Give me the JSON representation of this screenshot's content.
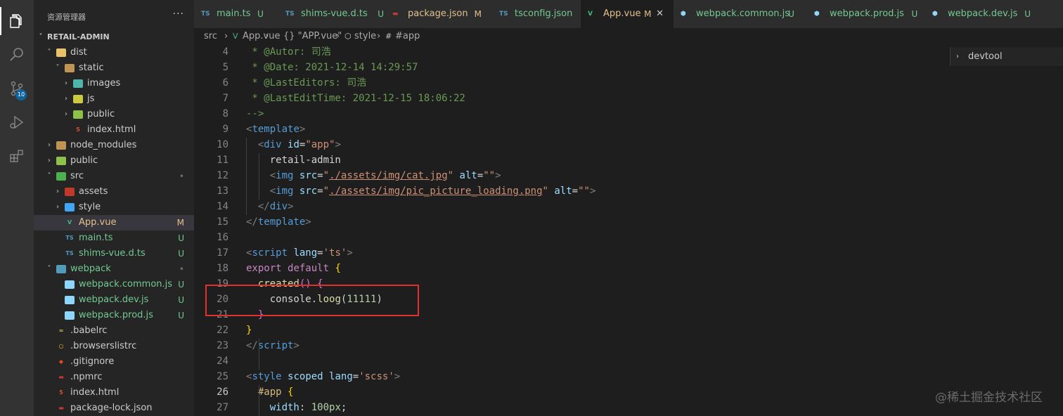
{
  "explorer": {
    "title": "资源管理器",
    "more": "···",
    "root_label": "RETAIL-ADMIN",
    "items": [
      {
        "label": "dist",
        "chev": "˅",
        "icon": "folder-icon",
        "color": "#e8c36a"
      },
      {
        "label": "static",
        "chev": "˅",
        "icon": "folder-open-icon",
        "color": "#c09553"
      },
      {
        "label": "images",
        "chev": "›",
        "icon": "images-folder-icon",
        "color": "#4db6ac"
      },
      {
        "label": "js",
        "chev": "›",
        "icon": "js-folder-icon",
        "color": "#cbcb41"
      },
      {
        "label": "public",
        "chev": "›",
        "icon": "public-folder-icon",
        "color": "#8dc149"
      },
      {
        "label": "index.html",
        "chev": "",
        "icon": "html5-icon",
        "color": "#e44d26",
        "glyph": "5"
      },
      {
        "label": "node_modules",
        "chev": "›",
        "icon": "folder-icon",
        "color": "#c09553"
      },
      {
        "label": "public",
        "chev": "›",
        "icon": "public-folder-icon",
        "color": "#8dc149"
      },
      {
        "label": "src",
        "chev": "˅",
        "icon": "src-folder-icon",
        "color": "#4caf50",
        "status": "•"
      },
      {
        "label": "assets",
        "chev": "›",
        "icon": "assets-folder-icon",
        "color": "#c0392b"
      },
      {
        "label": "style",
        "chev": "›",
        "icon": "style-folder-icon",
        "color": "#42a5f5"
      },
      {
        "label": "App.vue",
        "chev": "",
        "icon": "vue-icon",
        "color": "#41b883",
        "glyph": "V",
        "status": "M",
        "text_color": "#e2c08d"
      },
      {
        "label": "main.ts",
        "chev": "",
        "icon": "typescript-icon",
        "color": "#519aba",
        "glyph": "TS",
        "status": "U",
        "text_color": "#73c991"
      },
      {
        "label": "shims-vue.d.ts",
        "chev": "",
        "icon": "typescript-icon",
        "color": "#519aba",
        "glyph": "TS",
        "status": "U",
        "text_color": "#73c991"
      },
      {
        "label": "webpack",
        "chev": "˅",
        "icon": "webpack-folder-icon",
        "color": "#519aba",
        "status": "•",
        "text_color": "#73c991"
      },
      {
        "label": "webpack.common.js",
        "chev": "",
        "icon": "webpack-icon",
        "color": "#8ed6fb",
        "status": "U",
        "text_color": "#73c991"
      },
      {
        "label": "webpack.dev.js",
        "chev": "",
        "icon": "webpack-icon",
        "color": "#8ed6fb",
        "status": "U",
        "text_color": "#73c991"
      },
      {
        "label": "webpack.prod.js",
        "chev": "",
        "icon": "webpack-icon",
        "color": "#8ed6fb",
        "status": "U",
        "text_color": "#73c991"
      },
      {
        "label": ".babelrc",
        "chev": "",
        "icon": "babel-icon",
        "color": "#cbcb41",
        "glyph": "≈"
      },
      {
        "label": ".browserslistrc",
        "chev": "",
        "icon": "browserslist-icon",
        "color": "#f5c518",
        "glyph": "○"
      },
      {
        "label": ".gitignore",
        "chev": "",
        "icon": "git-icon",
        "color": "#e64a19",
        "glyph": "◆"
      },
      {
        "label": ".npmrc",
        "chev": "",
        "icon": "npm-icon",
        "color": "#cb3837",
        "glyph": "▬"
      },
      {
        "label": "index.html",
        "chev": "",
        "icon": "html5-icon",
        "color": "#e44d26",
        "glyph": "5"
      },
      {
        "label": "package-lock.json",
        "chev": "",
        "icon": "npm-icon",
        "color": "#cb3837",
        "glyph": "▬"
      }
    ]
  },
  "tabs": [
    {
      "label": "main.ts",
      "status": "U",
      "glyph": "TS",
      "icon": "typescript-icon",
      "color": "#519aba",
      "text_color": "#73c991"
    },
    {
      "label": "shims-vue.d.ts",
      "status": "U",
      "glyph": "TS",
      "icon": "typescript-icon",
      "color": "#519aba",
      "text_color": "#73c991"
    },
    {
      "label": "package.json",
      "status": "M",
      "glyph": "▬",
      "icon": "npm-icon",
      "color": "#cb3837",
      "text_color": "#e2c08d"
    },
    {
      "label": "tsconfig.json",
      "status": "U",
      "glyph": "TS",
      "icon": "typescript-icon",
      "color": "#519aba",
      "text_color": "#73c991"
    },
    {
      "label": "App.vue",
      "status": "M",
      "glyph": "V",
      "icon": "vue-icon",
      "color": "#41b883",
      "text_color": "#e2c08d",
      "active": true,
      "close": "✕"
    },
    {
      "label": "webpack.common.js",
      "status": "U",
      "glyph": "⬢",
      "icon": "webpack-icon",
      "color": "#8ed6fb",
      "text_color": "#73c991"
    },
    {
      "label": "webpack.prod.js",
      "status": "U",
      "glyph": "⬢",
      "icon": "webpack-icon",
      "color": "#8ed6fb",
      "text_color": "#73c991"
    },
    {
      "label": "webpack.dev.js",
      "status": "U",
      "glyph": "⬢",
      "icon": "webpack-icon",
      "color": "#8ed6fb",
      "text_color": "#73c991"
    }
  ],
  "breadcrumbs": [
    "src",
    "App.vue",
    "{} \"APP.vue\"",
    "style",
    "#app"
  ],
  "breadcrumb_sep": "›",
  "outline": {
    "label": "devtool",
    "chev": "›"
  },
  "code_lines": [
    {
      "n": "4",
      "tokens": [
        [
          "t-comment",
          " * @Autor: 司浩"
        ]
      ]
    },
    {
      "n": "5",
      "tokens": [
        [
          "t-comment",
          " * @Date: 2021-12-14 14:29:57"
        ]
      ]
    },
    {
      "n": "6",
      "tokens": [
        [
          "t-comment",
          " * @LastEditors: 司浩"
        ]
      ]
    },
    {
      "n": "7",
      "tokens": [
        [
          "t-comment",
          " * @LastEditTime: 2021-12-15 18:06:22"
        ]
      ]
    },
    {
      "n": "8",
      "tokens": [
        [
          "t-comment",
          "-->"
        ]
      ]
    },
    {
      "n": "9",
      "tokens": [
        [
          "t-punct",
          "<"
        ],
        [
          "t-tag",
          "template"
        ],
        [
          "t-punct",
          ">"
        ]
      ]
    },
    {
      "n": "10",
      "tokens": [
        [
          "t-text",
          "  "
        ],
        [
          "t-punct",
          "<"
        ],
        [
          "t-tag",
          "div"
        ],
        [
          "t-text",
          " "
        ],
        [
          "t-attr",
          "id"
        ],
        [
          "t-text",
          "="
        ],
        [
          "t-str",
          "\"app\""
        ],
        [
          "t-punct",
          ">"
        ]
      ]
    },
    {
      "n": "11",
      "tokens": [
        [
          "t-text",
          "    retail-admin"
        ]
      ]
    },
    {
      "n": "12",
      "tokens": [
        [
          "t-text",
          "    "
        ],
        [
          "t-punct",
          "<"
        ],
        [
          "t-tag",
          "img"
        ],
        [
          "t-text",
          " "
        ],
        [
          "t-attr",
          "src"
        ],
        [
          "t-text",
          "="
        ],
        [
          "t-str",
          "\""
        ],
        [
          "t-link",
          "./assets/img/cat.jpg"
        ],
        [
          "t-str",
          "\""
        ],
        [
          "t-text",
          " "
        ],
        [
          "t-attr",
          "alt"
        ],
        [
          "t-text",
          "="
        ],
        [
          "t-str",
          "\"\""
        ],
        [
          "t-punct",
          ">"
        ]
      ]
    },
    {
      "n": "13",
      "tokens": [
        [
          "t-text",
          "    "
        ],
        [
          "t-punct",
          "<"
        ],
        [
          "t-tag",
          "img"
        ],
        [
          "t-text",
          " "
        ],
        [
          "t-attr",
          "src"
        ],
        [
          "t-text",
          "="
        ],
        [
          "t-str",
          "\""
        ],
        [
          "t-link",
          "./assets/img/pic_picture_loading.png"
        ],
        [
          "t-str",
          "\""
        ],
        [
          "t-text",
          " "
        ],
        [
          "t-attr",
          "alt"
        ],
        [
          "t-text",
          "="
        ],
        [
          "t-str",
          "\"\""
        ],
        [
          "t-punct",
          ">"
        ]
      ]
    },
    {
      "n": "14",
      "tokens": [
        [
          "t-text",
          "  "
        ],
        [
          "t-punct",
          "</"
        ],
        [
          "t-tag",
          "div"
        ],
        [
          "t-punct",
          ">"
        ]
      ]
    },
    {
      "n": "15",
      "tokens": [
        [
          "t-punct",
          "</"
        ],
        [
          "t-tag",
          "template"
        ],
        [
          "t-punct",
          ">"
        ]
      ]
    },
    {
      "n": "16",
      "tokens": []
    },
    {
      "n": "17",
      "tokens": [
        [
          "t-punct",
          "<"
        ],
        [
          "t-tag",
          "script"
        ],
        [
          "t-text",
          " "
        ],
        [
          "t-attr",
          "lang"
        ],
        [
          "t-text",
          "="
        ],
        [
          "t-str",
          "'ts'"
        ],
        [
          "t-punct",
          ">"
        ]
      ]
    },
    {
      "n": "18",
      "tokens": [
        [
          "t-kw2",
          "export"
        ],
        [
          "t-text",
          " "
        ],
        [
          "t-kw2",
          "default"
        ],
        [
          "t-text",
          " "
        ],
        [
          "t-brace",
          "{"
        ]
      ]
    },
    {
      "n": "19",
      "tokens": [
        [
          "t-text",
          "  "
        ],
        [
          "t-fn",
          "created"
        ],
        [
          "t-brace2",
          "()"
        ],
        [
          "t-text",
          " "
        ],
        [
          "t-brace2",
          "{"
        ]
      ]
    },
    {
      "n": "20",
      "tokens": [
        [
          "t-text",
          "    console."
        ],
        [
          "t-fn",
          "loog"
        ],
        [
          "t-text",
          "("
        ],
        [
          "t-num",
          "11111"
        ],
        [
          "t-text",
          ")"
        ]
      ]
    },
    {
      "n": "21",
      "tokens": [
        [
          "t-text",
          "  "
        ],
        [
          "t-brace2",
          "}"
        ]
      ]
    },
    {
      "n": "22",
      "tokens": [
        [
          "t-brace",
          "}"
        ]
      ]
    },
    {
      "n": "23",
      "tokens": [
        [
          "t-punct",
          "</"
        ],
        [
          "t-tag",
          "script"
        ],
        [
          "t-punct",
          ">"
        ]
      ]
    },
    {
      "n": "24",
      "tokens": []
    },
    {
      "n": "25",
      "tokens": [
        [
          "t-punct",
          "<"
        ],
        [
          "t-tag",
          "style"
        ],
        [
          "t-text",
          " "
        ],
        [
          "t-attr",
          "scoped"
        ],
        [
          "t-text",
          " "
        ],
        [
          "t-attr",
          "lang"
        ],
        [
          "t-text",
          "="
        ],
        [
          "t-str",
          "'scss'"
        ],
        [
          "t-punct",
          ">"
        ]
      ]
    },
    {
      "n": "26",
      "active": true,
      "tokens": [
        [
          "t-text",
          "  "
        ],
        [
          "t-sel",
          "#app"
        ],
        [
          "t-text",
          " "
        ],
        [
          "t-brace",
          "{"
        ]
      ]
    },
    {
      "n": "27",
      "tokens": [
        [
          "t-text",
          "    "
        ],
        [
          "t-prop",
          "width"
        ],
        [
          "t-text",
          ": "
        ],
        [
          "t-num",
          "100px"
        ],
        [
          "t-text",
          ";"
        ]
      ]
    }
  ],
  "watermark": "@稀土掘金技术社区"
}
